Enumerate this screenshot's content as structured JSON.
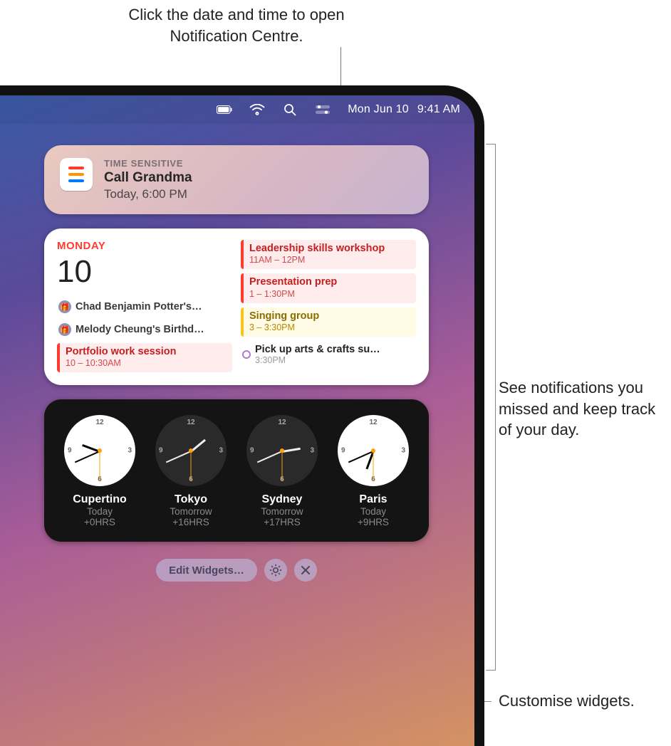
{
  "callouts": {
    "top": "Click the date and time to open Notification Centre.",
    "right": "See notifications you missed and keep track of your day.",
    "bottom": "Customise widgets."
  },
  "menubar": {
    "date": "Mon Jun 10",
    "time": "9:41 AM"
  },
  "notification": {
    "tag": "TIME SENSITIVE",
    "title": "Call Grandma",
    "subtitle": "Today, 6:00 PM"
  },
  "calendar": {
    "day_label": "MONDAY",
    "day_num": "10",
    "birthdays": [
      "Chad Benjamin Potter's…",
      "Melody Cheung's Birthd…"
    ],
    "left_events": [
      {
        "title": "Portfolio work session",
        "time": "10 – 10:30AM",
        "color": "red"
      }
    ],
    "right_events": [
      {
        "title": "Leadership skills workshop",
        "time": "11AM – 12PM",
        "color": "red"
      },
      {
        "title": "Presentation prep",
        "time": "1 – 1:30PM",
        "color": "red"
      },
      {
        "title": "Singing group",
        "time": "3 – 3:30PM",
        "color": "yellow"
      }
    ],
    "pickup": {
      "title": "Pick up arts & crafts su…",
      "time": "3:30PM"
    }
  },
  "worldclock": [
    {
      "city": "Cupertino",
      "day": "Today",
      "offset": "+0HRS",
      "dark": false,
      "h": 9,
      "m": 41
    },
    {
      "city": "Tokyo",
      "day": "Tomorrow",
      "offset": "+16HRS",
      "dark": true,
      "h": 1,
      "m": 41
    },
    {
      "city": "Sydney",
      "day": "Tomorrow",
      "offset": "+17HRS",
      "dark": true,
      "h": 2,
      "m": 41
    },
    {
      "city": "Paris",
      "day": "Today",
      "offset": "+9HRS",
      "dark": false,
      "h": 18,
      "m": 41
    }
  ],
  "buttons": {
    "edit": "Edit Widgets…"
  }
}
